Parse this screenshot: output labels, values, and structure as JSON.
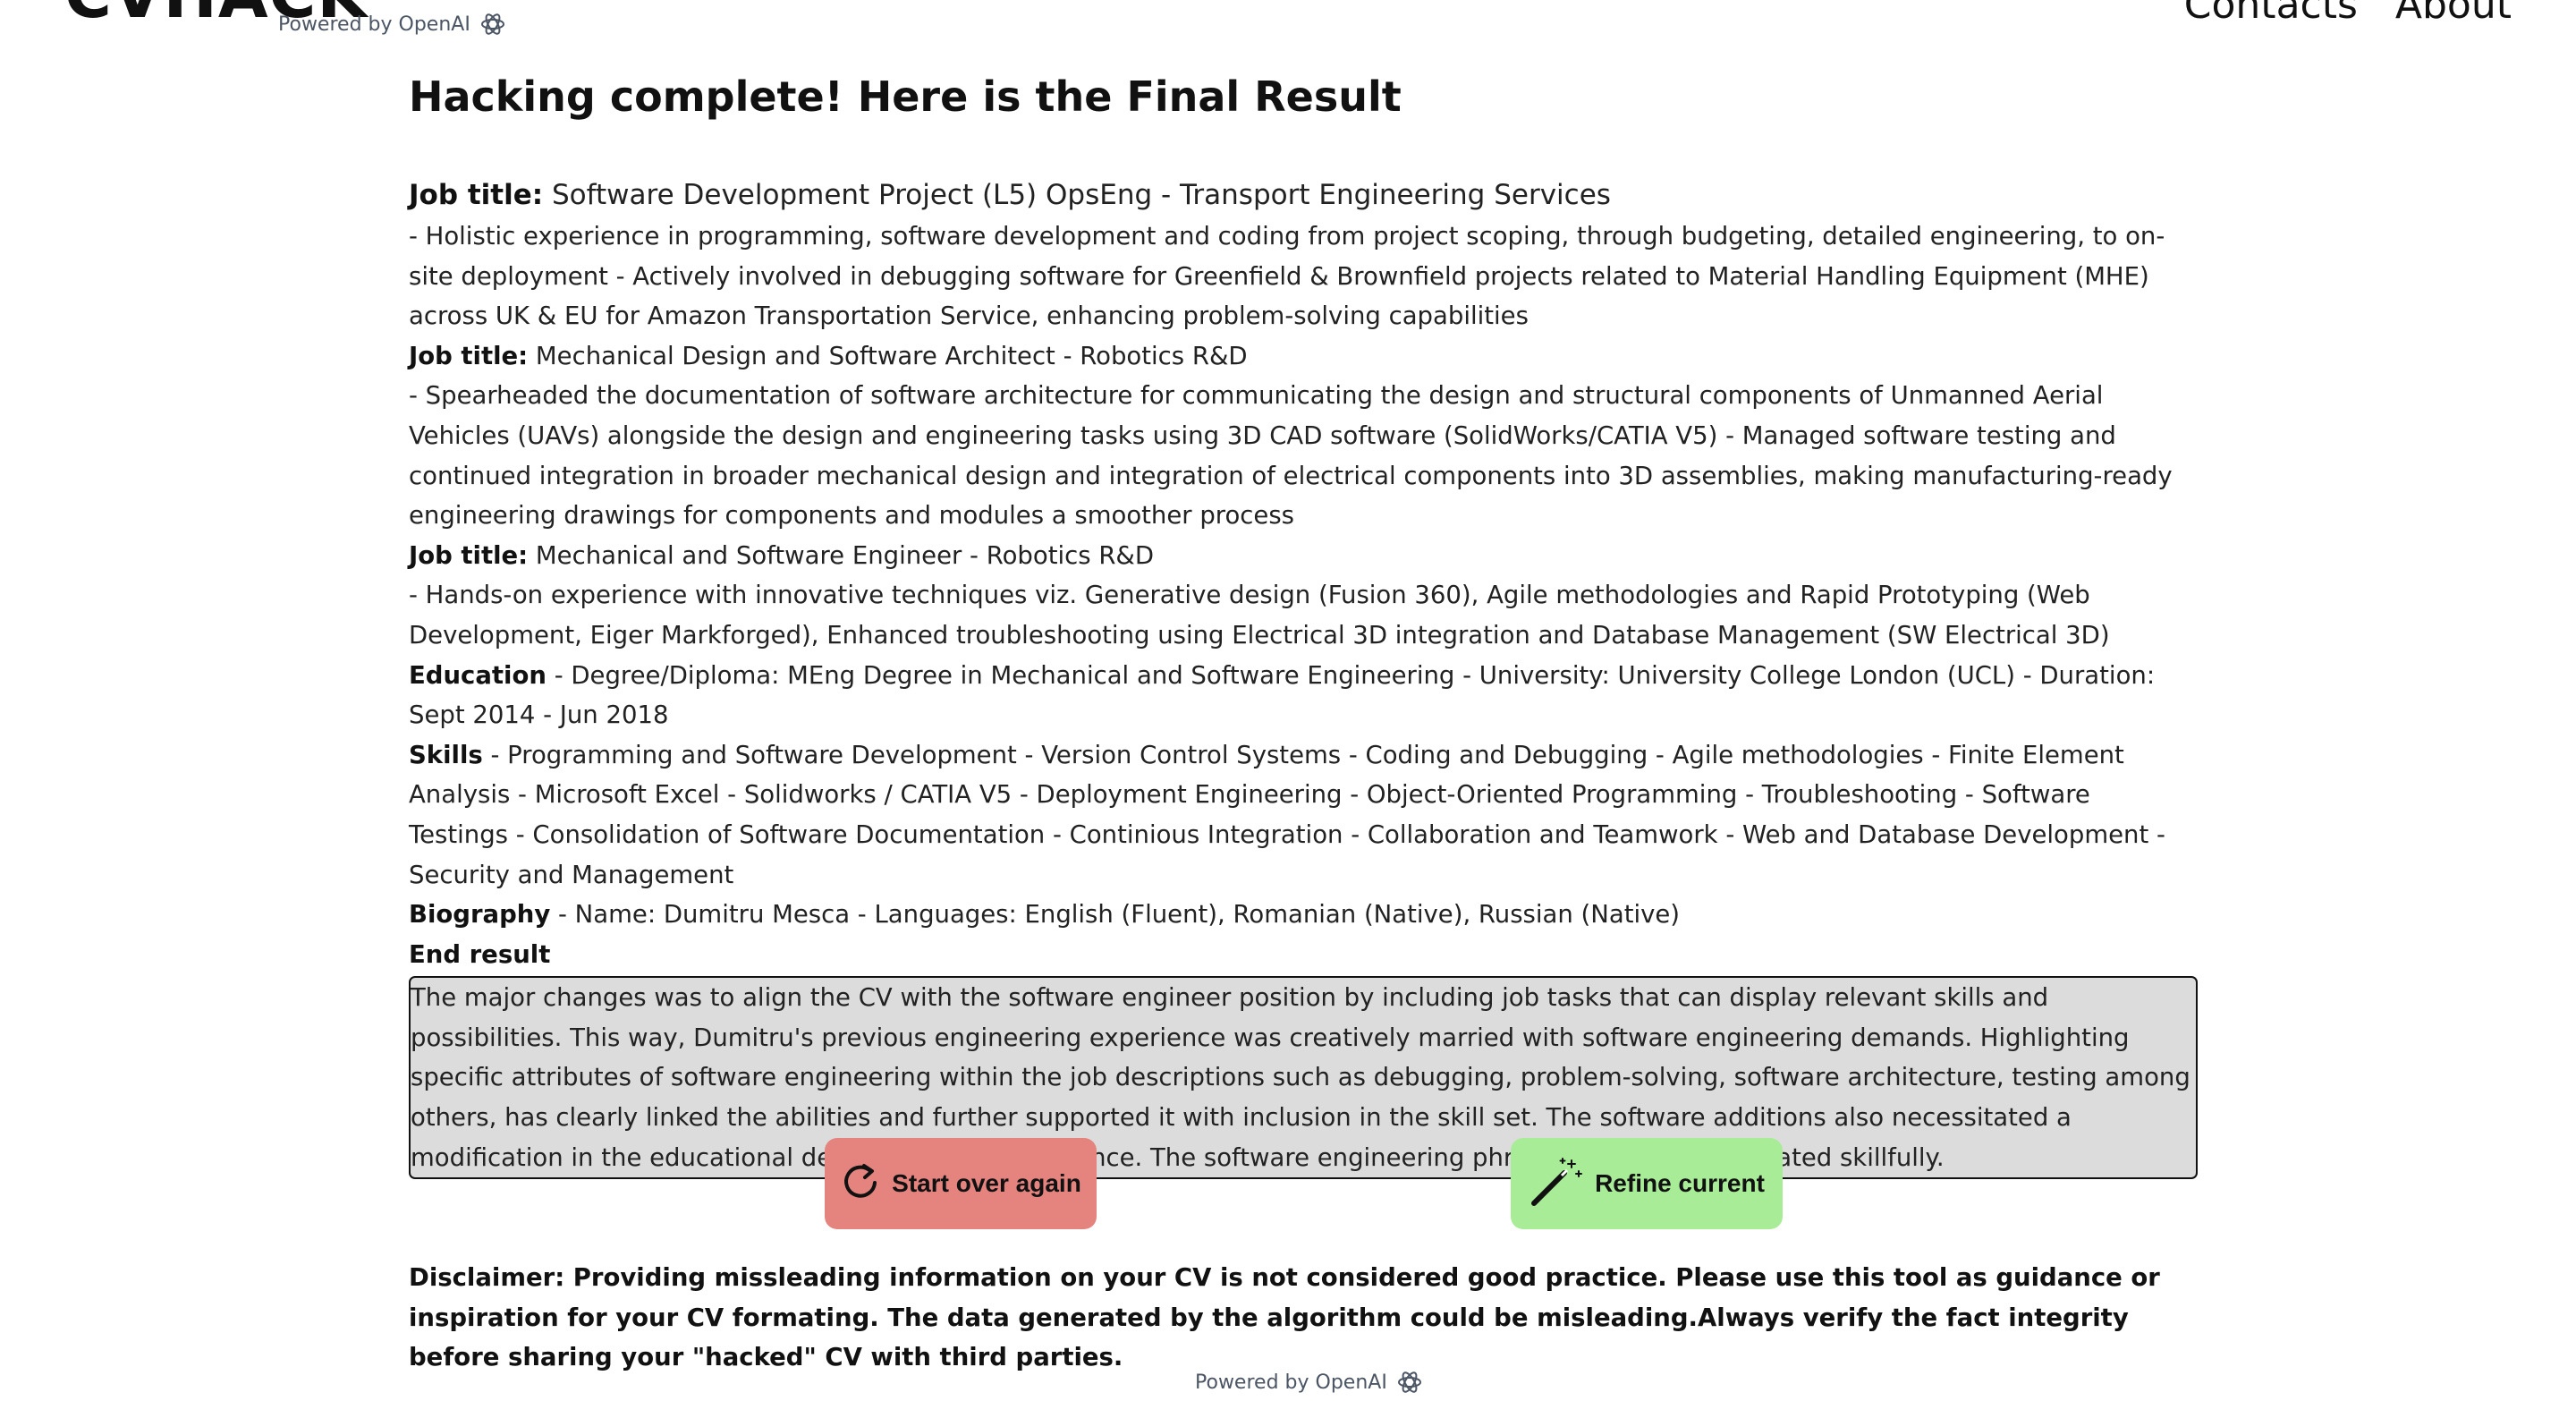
{
  "header": {
    "logo": "CVHACK",
    "powered_by": "Powered by OpenAI",
    "nav": [
      "Contacts",
      "About"
    ]
  },
  "page_title": "Hacking complete! Here is the Final Result",
  "resume": {
    "job1": {
      "label": "Job title:",
      "title": " Software Development Project (L5) OpsEng - Transport Engineering Services",
      "description": "- Holistic experience in programming, software development and coding from project scoping, through budgeting, detailed engineering, to on-site deployment - Actively involved in debugging software for Greenfield & Brownfield projects related to Material Handling Equipment (MHE) across UK & EU for Amazon Transportation Service, enhancing problem-solving capabilities"
    },
    "job2": {
      "label": "Job title:",
      "title": " Mechanical Design and Software Architect - Robotics R&D",
      "description": "- Spearheaded the documentation of software architecture for communicating the design and structural components of Unmanned Aerial Vehicles (UAVs) alongside the design and engineering tasks using 3D CAD software (SolidWorks/CATIA V5) - Managed software testing and continued integration in broader mechanical design and integration of electrical components into 3D assemblies, making manufacturing-ready engineering drawings for components and modules a smoother process"
    },
    "job3": {
      "label": "Job title:",
      "title": " Mechanical and Software Engineer - Robotics R&D",
      "description": "- Hands-on experience with innovative techniques viz. Generative design (Fusion 360), Agile methodologies and Rapid Prototyping (Web Development, Eiger Markforged), Enhanced troubleshooting using Electrical 3D integration and Database Management (SW Electrical 3D)"
    },
    "education": {
      "label": "Education",
      "text": " - Degree/Diploma: MEng Degree in Mechanical and Software Engineering - University: University College London (UCL) - Duration: Sept 2014 - Jun 2018"
    },
    "skills": {
      "label": "Skills",
      "text": " - Programming and Software Development - Version Control Systems - Coding and Debugging - Agile methodologies - Finite Element Analysis - Microsoft Excel - Solidworks / CATIA V5 - Deployment Engineering - Object-Oriented Programming - Troubleshooting - Software Testings - Consolidation of Software Documentation - Continious Integration - Collaboration and Teamwork - Web and Database Development - Security and Management"
    },
    "biography": {
      "label": "Biography",
      "text": " - Name: Dumitru Mesca - Languages: English (Fluent), Romanian (Native), Russian (Native)"
    },
    "end_result_label": "End result",
    "end_result_text": "The major changes was to align the CV with the software engineer position by including job tasks that can display relevant skills and possibilities. This way, Dumitru's previous engineering experience was creatively married with software engineering demands. Highlighting specific attributes of software engineering within the job descriptions such as debugging, problem-solving, software architecture, testing among others, has clearly linked the abilities and further supported it with inclusion in the skill set. The software additions also necessitated a modification in the educational degree to reflect relevance. The software engineering phrase is hence incorporated skillfully."
  },
  "buttons": {
    "start_over": "Start over again",
    "refine": "Refine current"
  },
  "disclaimer": "Disclaimer: Providing missleading information on your CV is not considered good practice. Please use this tool as guidance or inspiration for your CV formating. The data generated by the algorithm could be misleading.Always verify the fact integrity before sharing your \"hacked\" CV with third parties.",
  "footer": {
    "powered_by": "Powered by OpenAI"
  },
  "colors": {
    "start_button": "#e5837f",
    "refine_button": "#a8ec98",
    "result_box_bg": "#dcdcdc",
    "muted_text": "#4b5563"
  },
  "icons": [
    "openai-icon",
    "refresh-icon",
    "magic-wand-icon"
  ]
}
